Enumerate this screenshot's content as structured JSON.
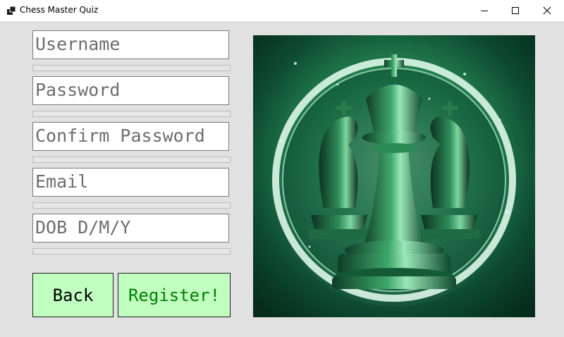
{
  "window": {
    "title": "Chess Master Quiz"
  },
  "form": {
    "username_placeholder": "Username",
    "password_placeholder": "Password",
    "confirm_password_placeholder": "Confirm Password",
    "email_placeholder": "Email",
    "dob_placeholder": "DOB D/M/Y"
  },
  "buttons": {
    "back_label": "Back",
    "register_label": "Register!"
  },
  "colors": {
    "button_bg": "#c0ffc0",
    "register_text": "#008000",
    "window_bg": "#e1e1e1"
  },
  "image": {
    "icon": "chess-pieces-artwork"
  }
}
